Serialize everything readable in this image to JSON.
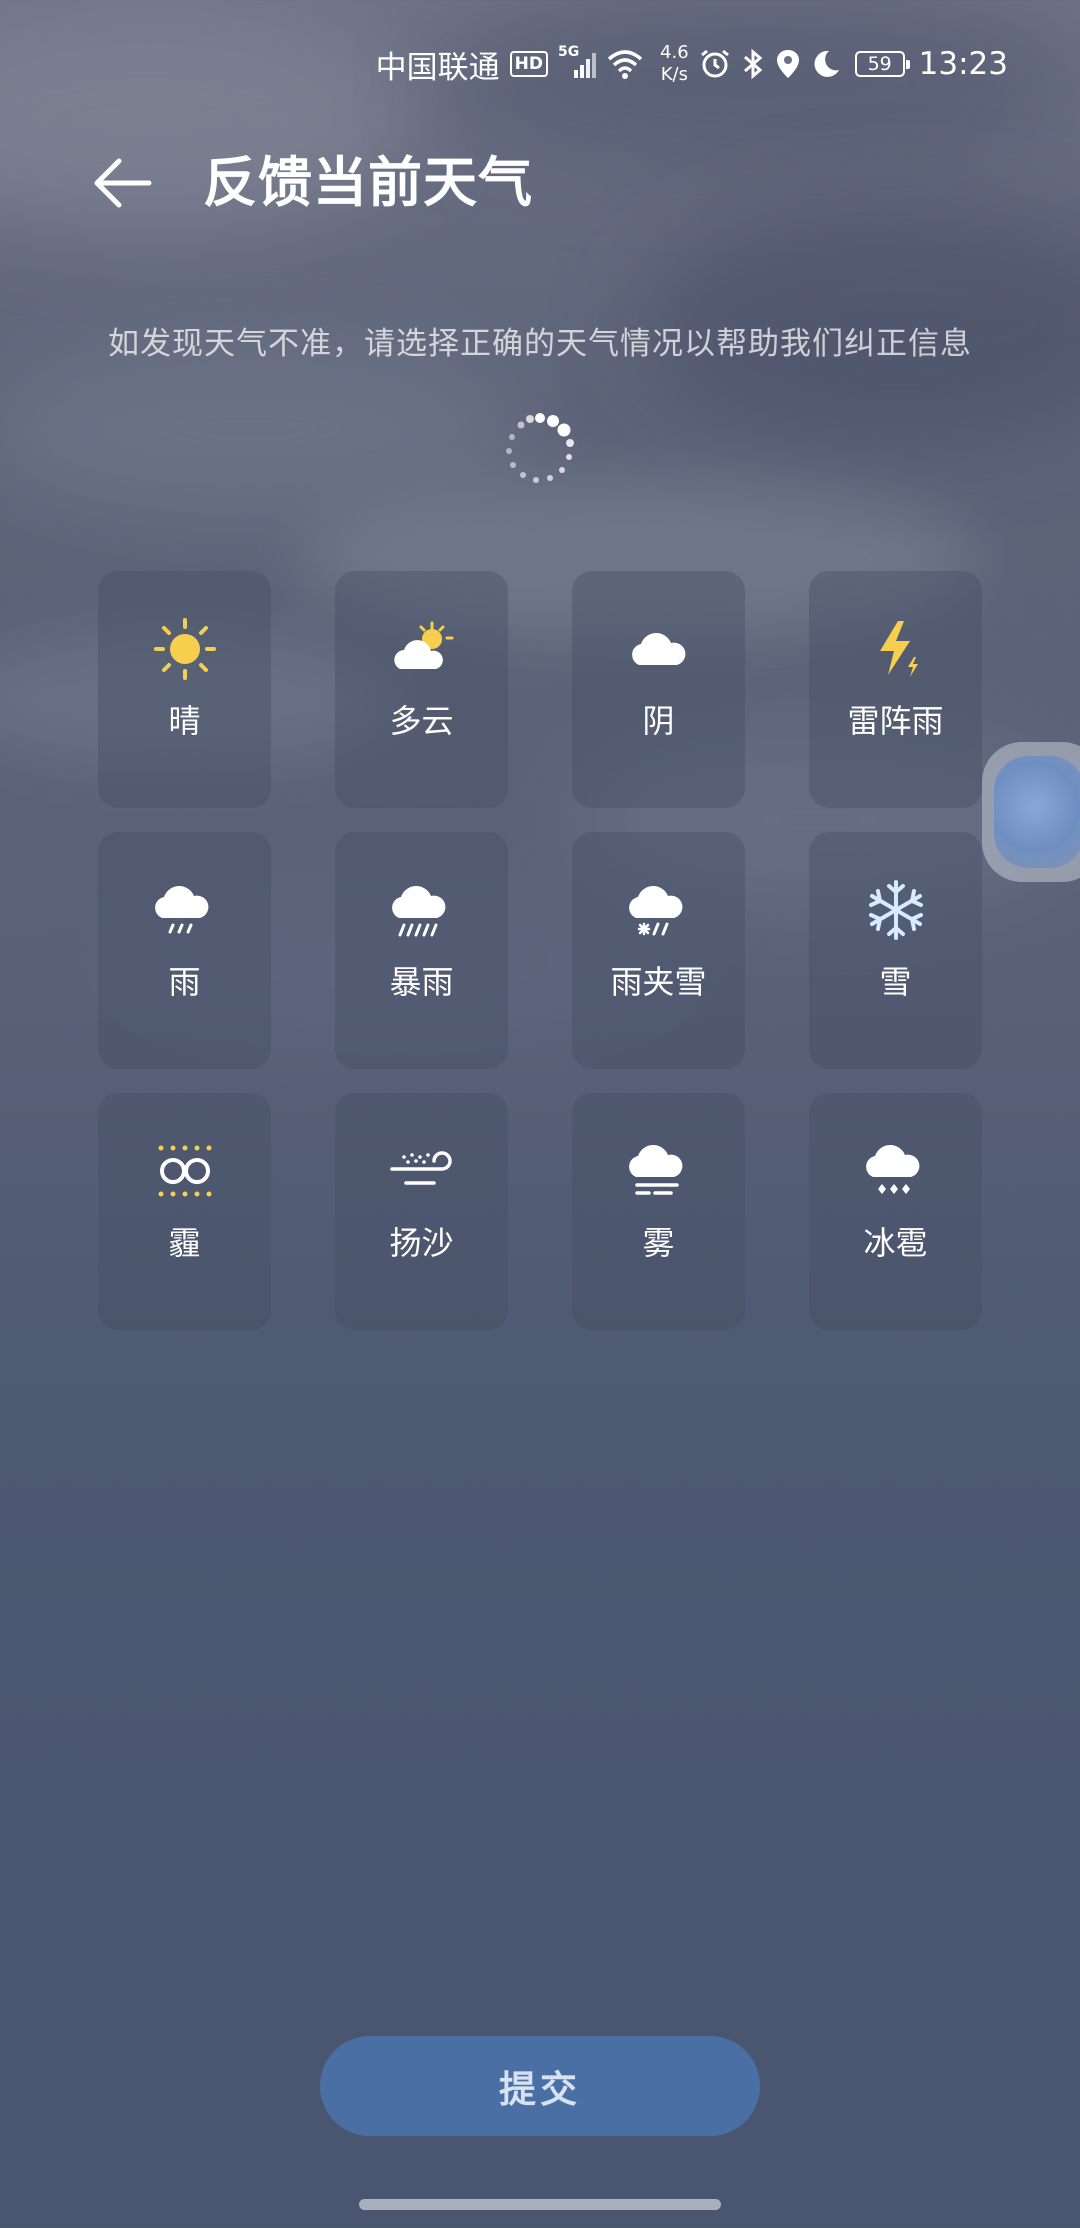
{
  "status_bar": {
    "carrier": "中国联通",
    "hd": "HD",
    "network": "5G",
    "net_speed_value": "4.6",
    "net_speed_unit": "K/s",
    "battery": "59",
    "time": "13:23"
  },
  "header": {
    "title": "反馈当前天气"
  },
  "subtitle": "如发现天气不准，请选择正确的天气情况以帮助我们纠正信息",
  "weather_options": [
    {
      "label": "晴",
      "icon": "sun-icon"
    },
    {
      "label": "多云",
      "icon": "partly-cloudy-icon"
    },
    {
      "label": "阴",
      "icon": "cloud-icon"
    },
    {
      "label": "雷阵雨",
      "icon": "thunder-icon"
    },
    {
      "label": "雨",
      "icon": "rain-icon"
    },
    {
      "label": "暴雨",
      "icon": "heavy-rain-icon"
    },
    {
      "label": "雨夹雪",
      "icon": "sleet-icon"
    },
    {
      "label": "雪",
      "icon": "snowflake-icon"
    },
    {
      "label": "霾",
      "icon": "haze-icon"
    },
    {
      "label": "扬沙",
      "icon": "sand-icon"
    },
    {
      "label": "雾",
      "icon": "fog-icon"
    },
    {
      "label": "冰雹",
      "icon": "hail-icon"
    }
  ],
  "submit_label": "提交",
  "colors": {
    "sun": "#f7cf4f",
    "snow": "#d6ebff",
    "submit_bg": "#4a6fa5"
  }
}
